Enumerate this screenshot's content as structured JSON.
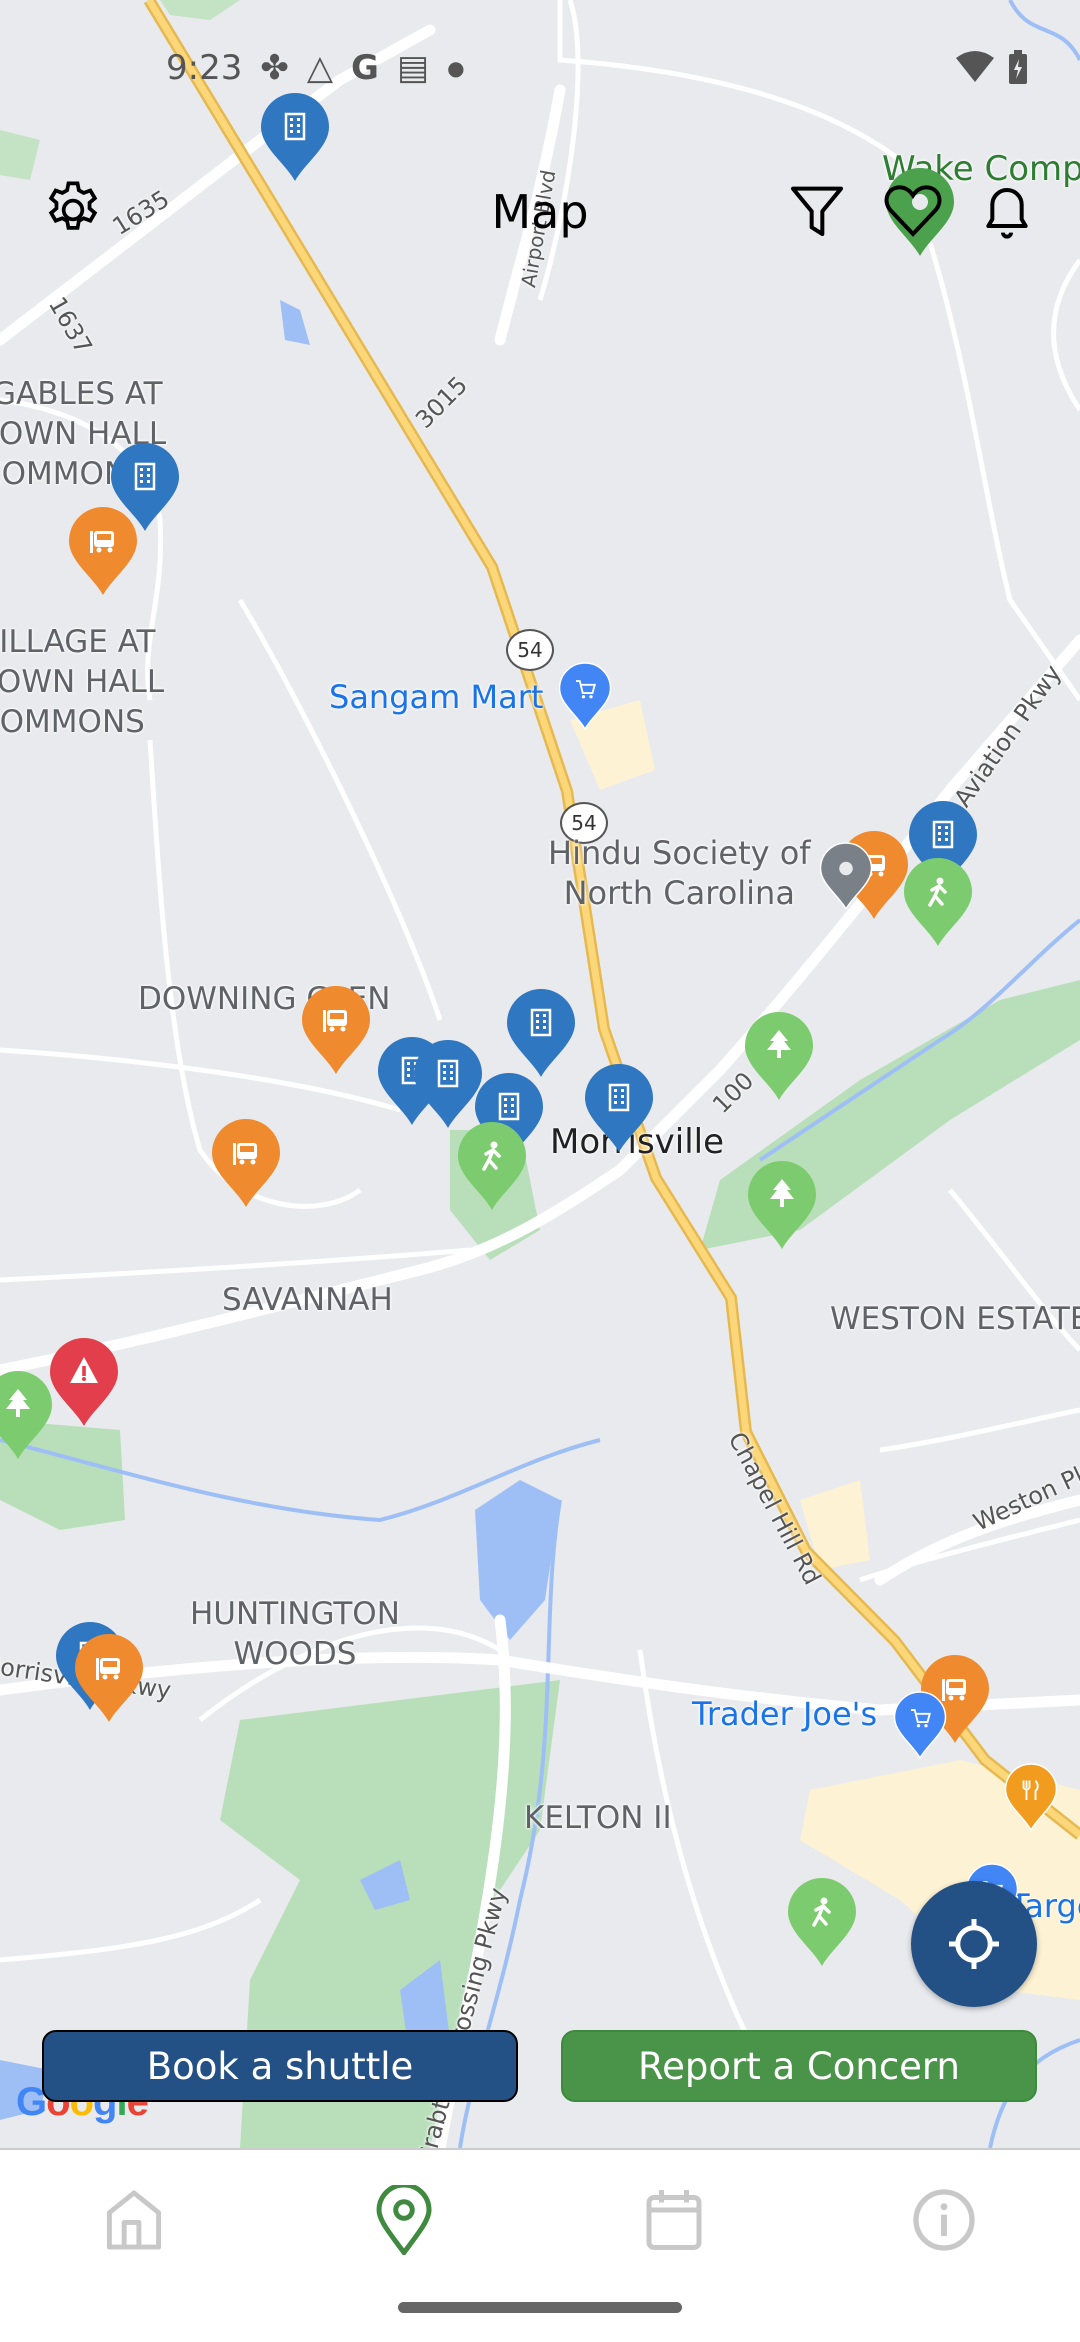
{
  "status_bar": {
    "time": "9:23"
  },
  "header": {
    "title": "Map",
    "icons": [
      "gear-icon",
      "filter-icon",
      "heart-icon",
      "bell-icon"
    ]
  },
  "map": {
    "neighborhoods": {
      "gables": [
        "GABLES AT",
        "TOWN HALL",
        "COMMONS"
      ],
      "village": [
        "VILLAGE AT",
        "TOWN HALL",
        "COMMONS"
      ],
      "downing": "DOWNING GLEN",
      "savannah": "SAVANNAH",
      "weston": "WESTON ESTATES",
      "huntington": [
        "HUNTINGTON",
        "WOODS"
      ],
      "kelton": "KELTON II"
    },
    "town": "Morrisville",
    "pois": {
      "sangam": "Sangam Mart",
      "hindu": [
        "Hindu Society of",
        "North Carolina"
      ],
      "traderjoes": "Trader Joe's",
      "target": "Target",
      "wake": "Wake Compe"
    },
    "roads": {
      "r1635": "1635",
      "r1637": "1637",
      "airport": "Airport Blvd",
      "r3015": "3015",
      "nc54a": "54",
      "nc54b": "54",
      "r100": "100",
      "aviation": "Aviation Pkwy",
      "chapelhill": "Chapel Hill Rd",
      "weston": "Weston Pkwy",
      "crabtree": "Crabtree Crossing Pkwy",
      "morrisville": "Morrisville Pkwy"
    },
    "attribution": "Google",
    "marker_colors": {
      "building": "#2f77c0",
      "bus": "#ef8a2f",
      "walk": "#7ccb6e",
      "tree": "#7ccb6e",
      "alert": "#e33e4c",
      "food": "#f29c1f"
    }
  },
  "actions": {
    "book_shuttle": "Book a shuttle",
    "report_concern": "Report a Concern"
  },
  "bottom_nav": {
    "items": [
      {
        "icon": "home-icon",
        "active": false
      },
      {
        "icon": "map-pin-icon",
        "active": true
      },
      {
        "icon": "calendar-icon",
        "active": false
      },
      {
        "icon": "info-icon",
        "active": false
      }
    ],
    "active_color": "#3f8a3f",
    "inactive_color": "#c8c8c8"
  }
}
